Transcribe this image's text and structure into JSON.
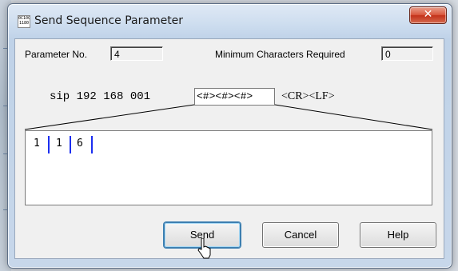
{
  "window": {
    "title": "Send Sequence Parameter",
    "close_glyph": "✕",
    "icon": "app-icon-0101"
  },
  "param": {
    "number_label": "Parameter No.",
    "number_value": "4",
    "min_label": "Minimum Characters Required",
    "min_value": "0"
  },
  "sequence": {
    "prefix": "sip 192 168 001",
    "field": "<#><#><#>",
    "suffix": "<CR><LF>"
  },
  "editor": {
    "digits": [
      "1",
      "1",
      "6"
    ]
  },
  "buttons": {
    "send": "Send",
    "cancel": "Cancel",
    "help": "Help"
  },
  "colors": {
    "separator": "#1b2ef0",
    "close": "#c3321a"
  }
}
